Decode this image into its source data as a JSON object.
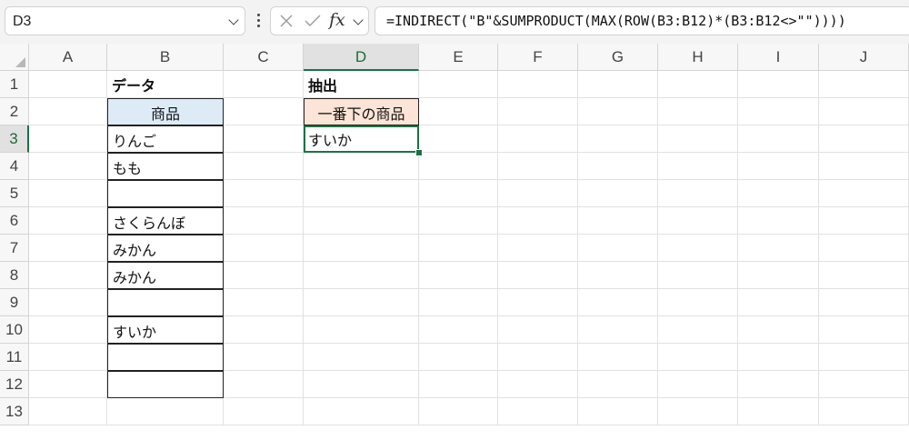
{
  "formula_bar": {
    "name_box": "D3",
    "fx_label": "fx",
    "formula": "=INDIRECT(\"B\"&SUMPRODUCT(MAX(ROW(B3:B12)*(B3:B12<>\"\"))))"
  },
  "columns": [
    "A",
    "B",
    "C",
    "D",
    "E",
    "F",
    "G",
    "H",
    "I",
    "J"
  ],
  "rows": [
    "1",
    "2",
    "3",
    "4",
    "5",
    "6",
    "7",
    "8",
    "9",
    "10",
    "11",
    "12",
    "13"
  ],
  "active_cell": {
    "column": "D",
    "row": "3"
  },
  "data_table": {
    "title": "データ",
    "header": "商品",
    "items": [
      "りんご",
      "もも",
      "",
      "さくらんぼ",
      "みかん",
      "みかん",
      "",
      "すいか",
      "",
      ""
    ]
  },
  "extract_table": {
    "title": "抽出",
    "header": "一番下の商品",
    "result": "すいか"
  },
  "colors": {
    "selection_green": "#1e7145",
    "data_header_fill": "#ddebf7",
    "extract_header_fill": "#fce4d6"
  }
}
